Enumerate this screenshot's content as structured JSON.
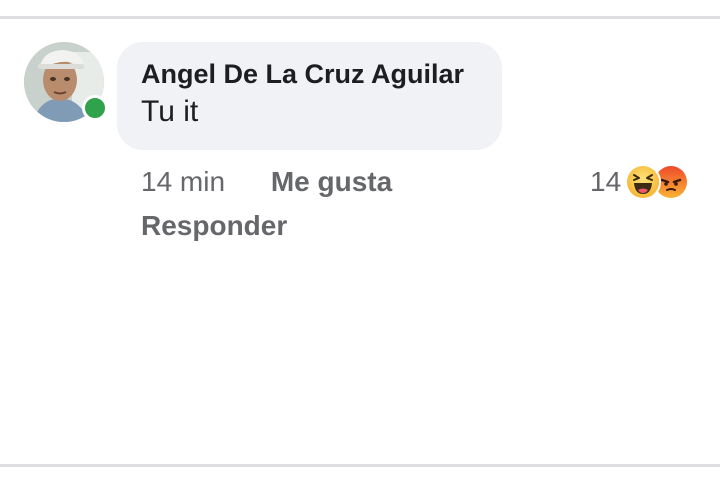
{
  "comment": {
    "author": "Angel De La Cruz Aguilar",
    "text": "Tu it",
    "time": "14 min",
    "like_label": "Me gusta",
    "reply_label": "Responder",
    "reaction_count": "14",
    "reactions": [
      "haha-emoji-icon",
      "angry-emoji-icon"
    ],
    "online": true
  },
  "colors": {
    "bubble": "#f0f2f5",
    "meta_text": "#65676b",
    "online": "#31a24c",
    "divider": "#dcdee1"
  }
}
